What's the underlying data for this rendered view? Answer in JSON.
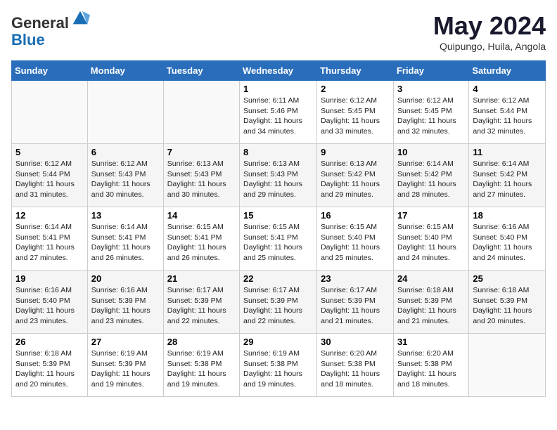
{
  "header": {
    "logo_line1": "General",
    "logo_line2": "Blue",
    "month_title": "May 2024",
    "subtitle": "Quipungo, Huila, Angola"
  },
  "days_of_week": [
    "Sunday",
    "Monday",
    "Tuesday",
    "Wednesday",
    "Thursday",
    "Friday",
    "Saturday"
  ],
  "weeks": [
    [
      {
        "day": "",
        "info": ""
      },
      {
        "day": "",
        "info": ""
      },
      {
        "day": "",
        "info": ""
      },
      {
        "day": "1",
        "info": "Sunrise: 6:11 AM\nSunset: 5:46 PM\nDaylight: 11 hours\nand 34 minutes."
      },
      {
        "day": "2",
        "info": "Sunrise: 6:12 AM\nSunset: 5:45 PM\nDaylight: 11 hours\nand 33 minutes."
      },
      {
        "day": "3",
        "info": "Sunrise: 6:12 AM\nSunset: 5:45 PM\nDaylight: 11 hours\nand 32 minutes."
      },
      {
        "day": "4",
        "info": "Sunrise: 6:12 AM\nSunset: 5:44 PM\nDaylight: 11 hours\nand 32 minutes."
      }
    ],
    [
      {
        "day": "5",
        "info": "Sunrise: 6:12 AM\nSunset: 5:44 PM\nDaylight: 11 hours\nand 31 minutes."
      },
      {
        "day": "6",
        "info": "Sunrise: 6:12 AM\nSunset: 5:43 PM\nDaylight: 11 hours\nand 30 minutes."
      },
      {
        "day": "7",
        "info": "Sunrise: 6:13 AM\nSunset: 5:43 PM\nDaylight: 11 hours\nand 30 minutes."
      },
      {
        "day": "8",
        "info": "Sunrise: 6:13 AM\nSunset: 5:43 PM\nDaylight: 11 hours\nand 29 minutes."
      },
      {
        "day": "9",
        "info": "Sunrise: 6:13 AM\nSunset: 5:42 PM\nDaylight: 11 hours\nand 29 minutes."
      },
      {
        "day": "10",
        "info": "Sunrise: 6:14 AM\nSunset: 5:42 PM\nDaylight: 11 hours\nand 28 minutes."
      },
      {
        "day": "11",
        "info": "Sunrise: 6:14 AM\nSunset: 5:42 PM\nDaylight: 11 hours\nand 27 minutes."
      }
    ],
    [
      {
        "day": "12",
        "info": "Sunrise: 6:14 AM\nSunset: 5:41 PM\nDaylight: 11 hours\nand 27 minutes."
      },
      {
        "day": "13",
        "info": "Sunrise: 6:14 AM\nSunset: 5:41 PM\nDaylight: 11 hours\nand 26 minutes."
      },
      {
        "day": "14",
        "info": "Sunrise: 6:15 AM\nSunset: 5:41 PM\nDaylight: 11 hours\nand 26 minutes."
      },
      {
        "day": "15",
        "info": "Sunrise: 6:15 AM\nSunset: 5:41 PM\nDaylight: 11 hours\nand 25 minutes."
      },
      {
        "day": "16",
        "info": "Sunrise: 6:15 AM\nSunset: 5:40 PM\nDaylight: 11 hours\nand 25 minutes."
      },
      {
        "day": "17",
        "info": "Sunrise: 6:15 AM\nSunset: 5:40 PM\nDaylight: 11 hours\nand 24 minutes."
      },
      {
        "day": "18",
        "info": "Sunrise: 6:16 AM\nSunset: 5:40 PM\nDaylight: 11 hours\nand 24 minutes."
      }
    ],
    [
      {
        "day": "19",
        "info": "Sunrise: 6:16 AM\nSunset: 5:40 PM\nDaylight: 11 hours\nand 23 minutes."
      },
      {
        "day": "20",
        "info": "Sunrise: 6:16 AM\nSunset: 5:39 PM\nDaylight: 11 hours\nand 23 minutes."
      },
      {
        "day": "21",
        "info": "Sunrise: 6:17 AM\nSunset: 5:39 PM\nDaylight: 11 hours\nand 22 minutes."
      },
      {
        "day": "22",
        "info": "Sunrise: 6:17 AM\nSunset: 5:39 PM\nDaylight: 11 hours\nand 22 minutes."
      },
      {
        "day": "23",
        "info": "Sunrise: 6:17 AM\nSunset: 5:39 PM\nDaylight: 11 hours\nand 21 minutes."
      },
      {
        "day": "24",
        "info": "Sunrise: 6:18 AM\nSunset: 5:39 PM\nDaylight: 11 hours\nand 21 minutes."
      },
      {
        "day": "25",
        "info": "Sunrise: 6:18 AM\nSunset: 5:39 PM\nDaylight: 11 hours\nand 20 minutes."
      }
    ],
    [
      {
        "day": "26",
        "info": "Sunrise: 6:18 AM\nSunset: 5:39 PM\nDaylight: 11 hours\nand 20 minutes."
      },
      {
        "day": "27",
        "info": "Sunrise: 6:19 AM\nSunset: 5:39 PM\nDaylight: 11 hours\nand 19 minutes."
      },
      {
        "day": "28",
        "info": "Sunrise: 6:19 AM\nSunset: 5:38 PM\nDaylight: 11 hours\nand 19 minutes."
      },
      {
        "day": "29",
        "info": "Sunrise: 6:19 AM\nSunset: 5:38 PM\nDaylight: 11 hours\nand 19 minutes."
      },
      {
        "day": "30",
        "info": "Sunrise: 6:20 AM\nSunset: 5:38 PM\nDaylight: 11 hours\nand 18 minutes."
      },
      {
        "day": "31",
        "info": "Sunrise: 6:20 AM\nSunset: 5:38 PM\nDaylight: 11 hours\nand 18 minutes."
      },
      {
        "day": "",
        "info": ""
      }
    ]
  ]
}
